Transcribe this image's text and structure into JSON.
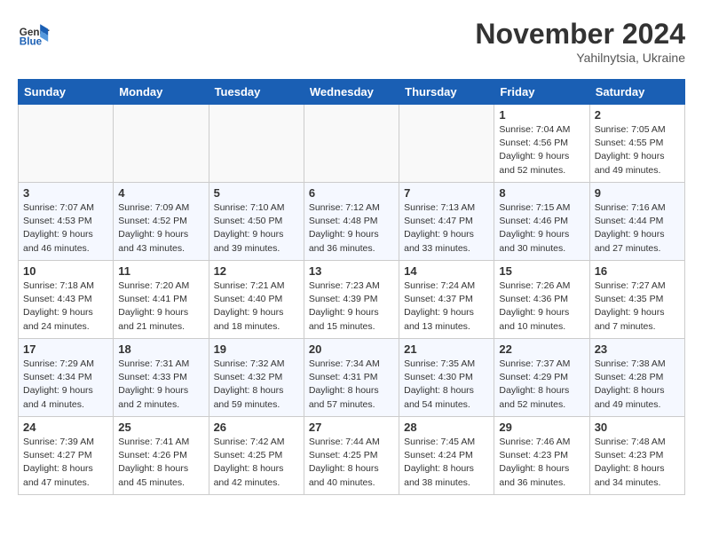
{
  "header": {
    "logo_general": "General",
    "logo_blue": "Blue",
    "month_title": "November 2024",
    "subtitle": "Yahilnytsia, Ukraine"
  },
  "days_of_week": [
    "Sunday",
    "Monday",
    "Tuesday",
    "Wednesday",
    "Thursday",
    "Friday",
    "Saturday"
  ],
  "weeks": [
    [
      {
        "day": "",
        "info": ""
      },
      {
        "day": "",
        "info": ""
      },
      {
        "day": "",
        "info": ""
      },
      {
        "day": "",
        "info": ""
      },
      {
        "day": "",
        "info": ""
      },
      {
        "day": "1",
        "info": "Sunrise: 7:04 AM\nSunset: 4:56 PM\nDaylight: 9 hours and 52 minutes."
      },
      {
        "day": "2",
        "info": "Sunrise: 7:05 AM\nSunset: 4:55 PM\nDaylight: 9 hours and 49 minutes."
      }
    ],
    [
      {
        "day": "3",
        "info": "Sunrise: 7:07 AM\nSunset: 4:53 PM\nDaylight: 9 hours and 46 minutes."
      },
      {
        "day": "4",
        "info": "Sunrise: 7:09 AM\nSunset: 4:52 PM\nDaylight: 9 hours and 43 minutes."
      },
      {
        "day": "5",
        "info": "Sunrise: 7:10 AM\nSunset: 4:50 PM\nDaylight: 9 hours and 39 minutes."
      },
      {
        "day": "6",
        "info": "Sunrise: 7:12 AM\nSunset: 4:48 PM\nDaylight: 9 hours and 36 minutes."
      },
      {
        "day": "7",
        "info": "Sunrise: 7:13 AM\nSunset: 4:47 PM\nDaylight: 9 hours and 33 minutes."
      },
      {
        "day": "8",
        "info": "Sunrise: 7:15 AM\nSunset: 4:46 PM\nDaylight: 9 hours and 30 minutes."
      },
      {
        "day": "9",
        "info": "Sunrise: 7:16 AM\nSunset: 4:44 PM\nDaylight: 9 hours and 27 minutes."
      }
    ],
    [
      {
        "day": "10",
        "info": "Sunrise: 7:18 AM\nSunset: 4:43 PM\nDaylight: 9 hours and 24 minutes."
      },
      {
        "day": "11",
        "info": "Sunrise: 7:20 AM\nSunset: 4:41 PM\nDaylight: 9 hours and 21 minutes."
      },
      {
        "day": "12",
        "info": "Sunrise: 7:21 AM\nSunset: 4:40 PM\nDaylight: 9 hours and 18 minutes."
      },
      {
        "day": "13",
        "info": "Sunrise: 7:23 AM\nSunset: 4:39 PM\nDaylight: 9 hours and 15 minutes."
      },
      {
        "day": "14",
        "info": "Sunrise: 7:24 AM\nSunset: 4:37 PM\nDaylight: 9 hours and 13 minutes."
      },
      {
        "day": "15",
        "info": "Sunrise: 7:26 AM\nSunset: 4:36 PM\nDaylight: 9 hours and 10 minutes."
      },
      {
        "day": "16",
        "info": "Sunrise: 7:27 AM\nSunset: 4:35 PM\nDaylight: 9 hours and 7 minutes."
      }
    ],
    [
      {
        "day": "17",
        "info": "Sunrise: 7:29 AM\nSunset: 4:34 PM\nDaylight: 9 hours and 4 minutes."
      },
      {
        "day": "18",
        "info": "Sunrise: 7:31 AM\nSunset: 4:33 PM\nDaylight: 9 hours and 2 minutes."
      },
      {
        "day": "19",
        "info": "Sunrise: 7:32 AM\nSunset: 4:32 PM\nDaylight: 8 hours and 59 minutes."
      },
      {
        "day": "20",
        "info": "Sunrise: 7:34 AM\nSunset: 4:31 PM\nDaylight: 8 hours and 57 minutes."
      },
      {
        "day": "21",
        "info": "Sunrise: 7:35 AM\nSunset: 4:30 PM\nDaylight: 8 hours and 54 minutes."
      },
      {
        "day": "22",
        "info": "Sunrise: 7:37 AM\nSunset: 4:29 PM\nDaylight: 8 hours and 52 minutes."
      },
      {
        "day": "23",
        "info": "Sunrise: 7:38 AM\nSunset: 4:28 PM\nDaylight: 8 hours and 49 minutes."
      }
    ],
    [
      {
        "day": "24",
        "info": "Sunrise: 7:39 AM\nSunset: 4:27 PM\nDaylight: 8 hours and 47 minutes."
      },
      {
        "day": "25",
        "info": "Sunrise: 7:41 AM\nSunset: 4:26 PM\nDaylight: 8 hours and 45 minutes."
      },
      {
        "day": "26",
        "info": "Sunrise: 7:42 AM\nSunset: 4:25 PM\nDaylight: 8 hours and 42 minutes."
      },
      {
        "day": "27",
        "info": "Sunrise: 7:44 AM\nSunset: 4:25 PM\nDaylight: 8 hours and 40 minutes."
      },
      {
        "day": "28",
        "info": "Sunrise: 7:45 AM\nSunset: 4:24 PM\nDaylight: 8 hours and 38 minutes."
      },
      {
        "day": "29",
        "info": "Sunrise: 7:46 AM\nSunset: 4:23 PM\nDaylight: 8 hours and 36 minutes."
      },
      {
        "day": "30",
        "info": "Sunrise: 7:48 AM\nSunset: 4:23 PM\nDaylight: 8 hours and 34 minutes."
      }
    ]
  ]
}
